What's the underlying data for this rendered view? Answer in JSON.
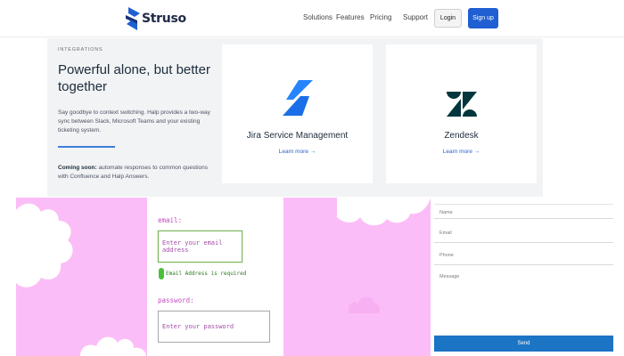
{
  "header": {
    "logo_text": "Struso",
    "nav": [
      "Solutions",
      "Features",
      "Pricing",
      "Support"
    ],
    "login_label": "Login",
    "signup_label": "Sign up"
  },
  "mega": {
    "eyebrow": "INTEGRATIONS",
    "title": "Powerful alone, but better together",
    "description": "Say goodbye to context switching. Halp provides a two-way sync between Slack, Microsoft Teams and your existing ticketing system.",
    "coming_soon_label": "Coming soon:",
    "coming_soon_text": " automate responses to common questions with Confluence and Halp Answers.",
    "cards": [
      {
        "title": "Jira Service Management",
        "link": "Learn more →",
        "icon": "jira-icon"
      },
      {
        "title": "Zendesk",
        "link": "Learn more →",
        "icon": "zendesk-icon"
      }
    ]
  },
  "login_form": {
    "email_label": "email:",
    "email_placeholder": "Enter your email address",
    "validation_message": "Email Address is required",
    "password_label": "password:",
    "password_placeholder": "Enter your password"
  },
  "contact_form": {
    "name_placeholder": "Name",
    "email_placeholder": "Email",
    "phone_placeholder": "Phone",
    "message_placeholder": "Message",
    "send_label": "Send"
  },
  "colors": {
    "brand_blue": "#1f5fd1",
    "pink_background": "#fbbdf7",
    "send_button": "#1c74c5",
    "valid_green": "#4cbf3a"
  }
}
